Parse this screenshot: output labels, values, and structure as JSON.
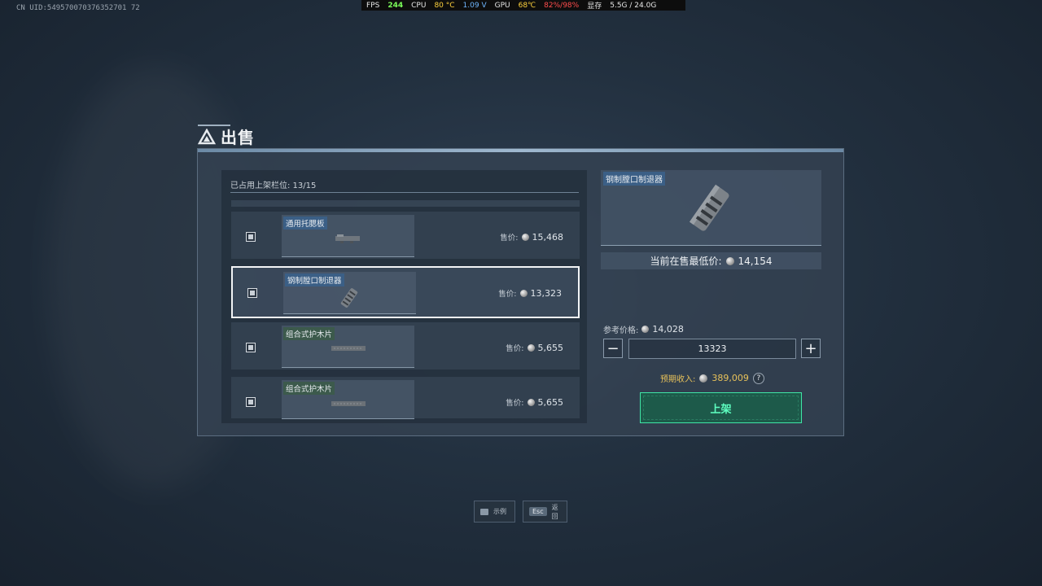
{
  "overlay": {
    "uid": "CN UID:549570070376352701 72",
    "perf": {
      "fps_label": "FPS",
      "fps": "244",
      "cpu_label": "CPU",
      "cpu_temp": "80 °C",
      "cpu_volt": "1.09 V",
      "gpu_label": "GPU",
      "gpu_temp": "68℃",
      "gpu_load": "82%/98%",
      "vram_label": "显存",
      "vram": "5.5G / 24.0G"
    }
  },
  "dialog": {
    "title": "出售",
    "slots_used": "已占用上架栏位: 13/15",
    "items": [
      {
        "name": "通用托腮板",
        "price_label": "售价:",
        "price": "15,468",
        "tag_color": "blue",
        "selected": false
      },
      {
        "name": "钢制膛口制退器",
        "price_label": "售价:",
        "price": "13,323",
        "tag_color": "blue",
        "selected": true
      },
      {
        "name": "组合式护木片",
        "price_label": "售价:",
        "price": "5,655",
        "tag_color": "green",
        "selected": false
      },
      {
        "name": "组合式护木片",
        "price_label": "售价:",
        "price": "5,655",
        "tag_color": "green",
        "selected": false
      }
    ],
    "detail": {
      "item_name": "钢制膛口制退器",
      "lowest_label": "当前在售最低价:",
      "lowest_price": "14,154",
      "ref_label": "参考价格:",
      "ref_price": "14,028",
      "quantity": "13323",
      "minus": "−",
      "plus": "+",
      "income_label": "预期收入:",
      "income_value": "389,009",
      "help": "?",
      "submit_label": "上架"
    }
  },
  "footer": {
    "hint1_label": "示例",
    "hint2_key": "Esc",
    "hint2_label": "返回"
  },
  "colors": {
    "accent_green": "#5effc0",
    "income_gold": "#e8c25a",
    "tag_blue": "#3b5f86",
    "tag_green": "#3c5a4c"
  }
}
